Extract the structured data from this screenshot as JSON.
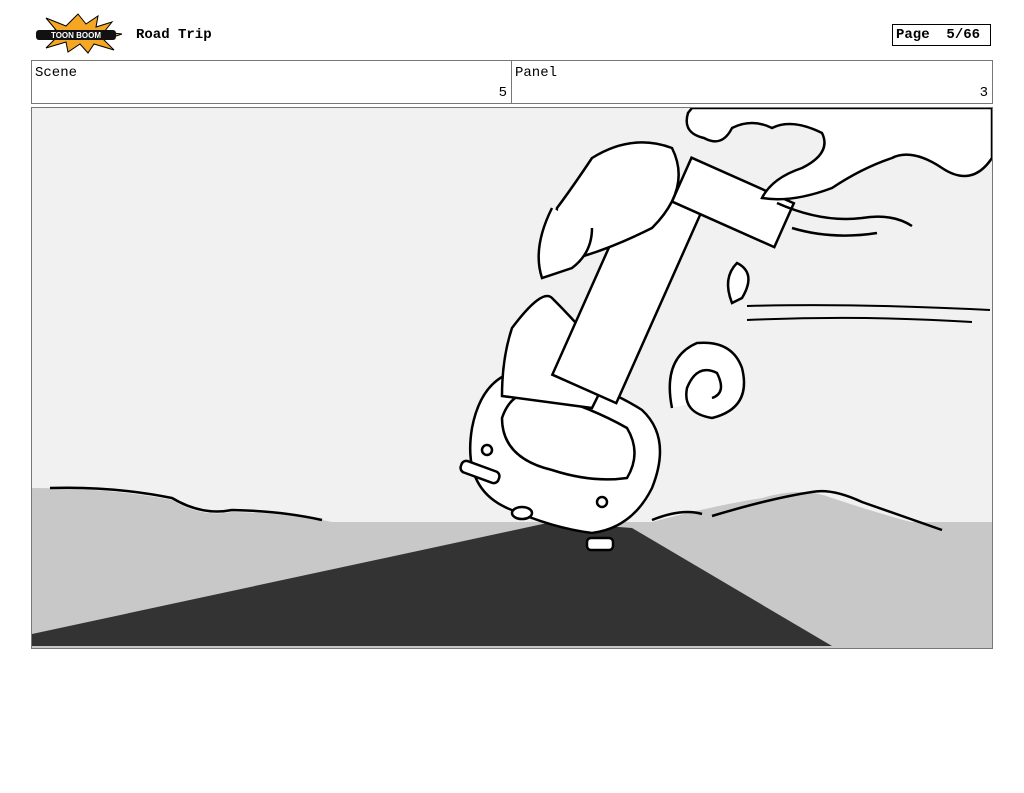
{
  "header": {
    "logo_text": "TOON BOOM",
    "project_title": "Road Trip",
    "page_label": "Page",
    "page_value": "5/66"
  },
  "info": {
    "scene_label": "Scene",
    "scene_value": "5",
    "panel_label": "Panel",
    "panel_value": "3"
  },
  "colors": {
    "sky": "#f1f1f1",
    "hills": "#c8c8c8",
    "road": "#333333",
    "logo_orange": "#f5a623"
  }
}
